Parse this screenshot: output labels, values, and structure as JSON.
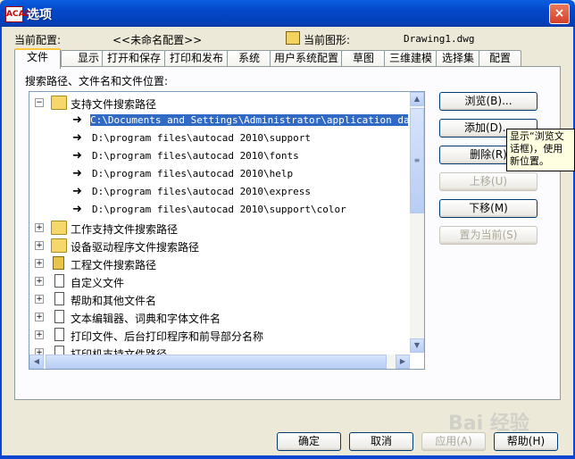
{
  "window": {
    "title": "选项",
    "app_icon": "ACAD",
    "close": "×"
  },
  "config": {
    "label": "当前配置:",
    "value": "<<未命名配置>>"
  },
  "drawing": {
    "label": "当前图形:",
    "value": "Drawing1.dwg"
  },
  "tabs": [
    "文件",
    "显示",
    "打开和保存",
    "打印和发布",
    "系统",
    "用户系统配置",
    "草图",
    "三维建模",
    "选择集",
    "配置"
  ],
  "active_tab": "文件",
  "section_label": "搜索路径、文件名和文件位置:",
  "tree": {
    "items": [
      {
        "label": "支持文件搜索路径",
        "expanded": true,
        "icon": "folder-icon"
      },
      {
        "label": "C:\\Documents and Settings\\Administrator\\application data\\au",
        "child": true,
        "selected": true
      },
      {
        "label": "D:\\program files\\autocad 2010\\support",
        "child": true
      },
      {
        "label": "D:\\program files\\autocad 2010\\fonts",
        "child": true
      },
      {
        "label": "D:\\program files\\autocad 2010\\help",
        "child": true
      },
      {
        "label": "D:\\program files\\autocad 2010\\express",
        "child": true
      },
      {
        "label": "D:\\program files\\autocad 2010\\support\\color",
        "child": true
      },
      {
        "label": "工作支持文件搜索路径",
        "icon": "folder-icon"
      },
      {
        "label": "设备驱动程序文件搜索路径",
        "icon": "folder-icon"
      },
      {
        "label": "工程文件搜索路径",
        "icon": "project-icon"
      },
      {
        "label": "自定义文件",
        "icon": "document-icon"
      },
      {
        "label": "帮助和其他文件名",
        "icon": "document-icon"
      },
      {
        "label": "文本编辑器、词典和字体文件名",
        "icon": "document-icon"
      },
      {
        "label": "打印文件、后台打印程序和前导部分名称",
        "icon": "document-icon"
      },
      {
        "label": "打印机支持文件路径",
        "icon": "document-icon"
      }
    ]
  },
  "side_buttons": {
    "browse": "浏览(B)...",
    "add": "添加(D)...",
    "remove": "删除(R)",
    "move_up": "上移(U)",
    "move_down": "下移(M)",
    "set_current": "置为当前(S)"
  },
  "tooltip": {
    "line1": "显示“浏览文",
    "line2": "话框)，使用",
    "line3": "新位置。"
  },
  "footer_buttons": {
    "ok": "确定",
    "cancel": "取消",
    "apply": "应用(A)",
    "help": "帮助(H)"
  },
  "watermark": "Bai 经验"
}
